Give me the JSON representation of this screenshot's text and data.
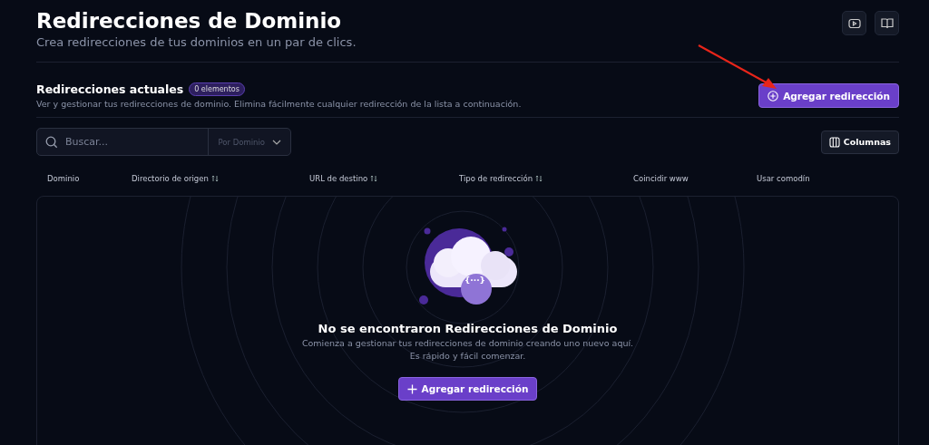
{
  "header": {
    "title": "Redirecciones de Dominio",
    "subtitle": "Crea redirecciones de tus dominios en un par de clics."
  },
  "section": {
    "title": "Redirecciones actuales",
    "count_badge": "0 elementos",
    "description": "Ver y gestionar tus redirecciones de dominio. Elimina fácilmente cualquier redirección de la lista a continuación.",
    "add_button": "Agregar redirección"
  },
  "search": {
    "placeholder": "Buscar...",
    "filter": "Por Dominio"
  },
  "columns_button": "Columnas",
  "table": {
    "columns": [
      {
        "label": "Dominio",
        "sortable": false
      },
      {
        "label": "Directorio de origen",
        "sortable": true
      },
      {
        "label": "URL de destino",
        "sortable": true
      },
      {
        "label": "Tipo de redirección",
        "sortable": true
      },
      {
        "label": "Coincidir www",
        "sortable": false
      },
      {
        "label": "Usar comodín",
        "sortable": false
      }
    ]
  },
  "empty_state": {
    "badge": "{···}",
    "title": "No se encontraron Redirecciones de Dominio",
    "lines": [
      "Comienza a gestionar tus redirecciones de dominio creando uno nuevo aquí.",
      "Es rápido y fácil comenzar."
    ],
    "button": "Agregar redirección"
  }
}
